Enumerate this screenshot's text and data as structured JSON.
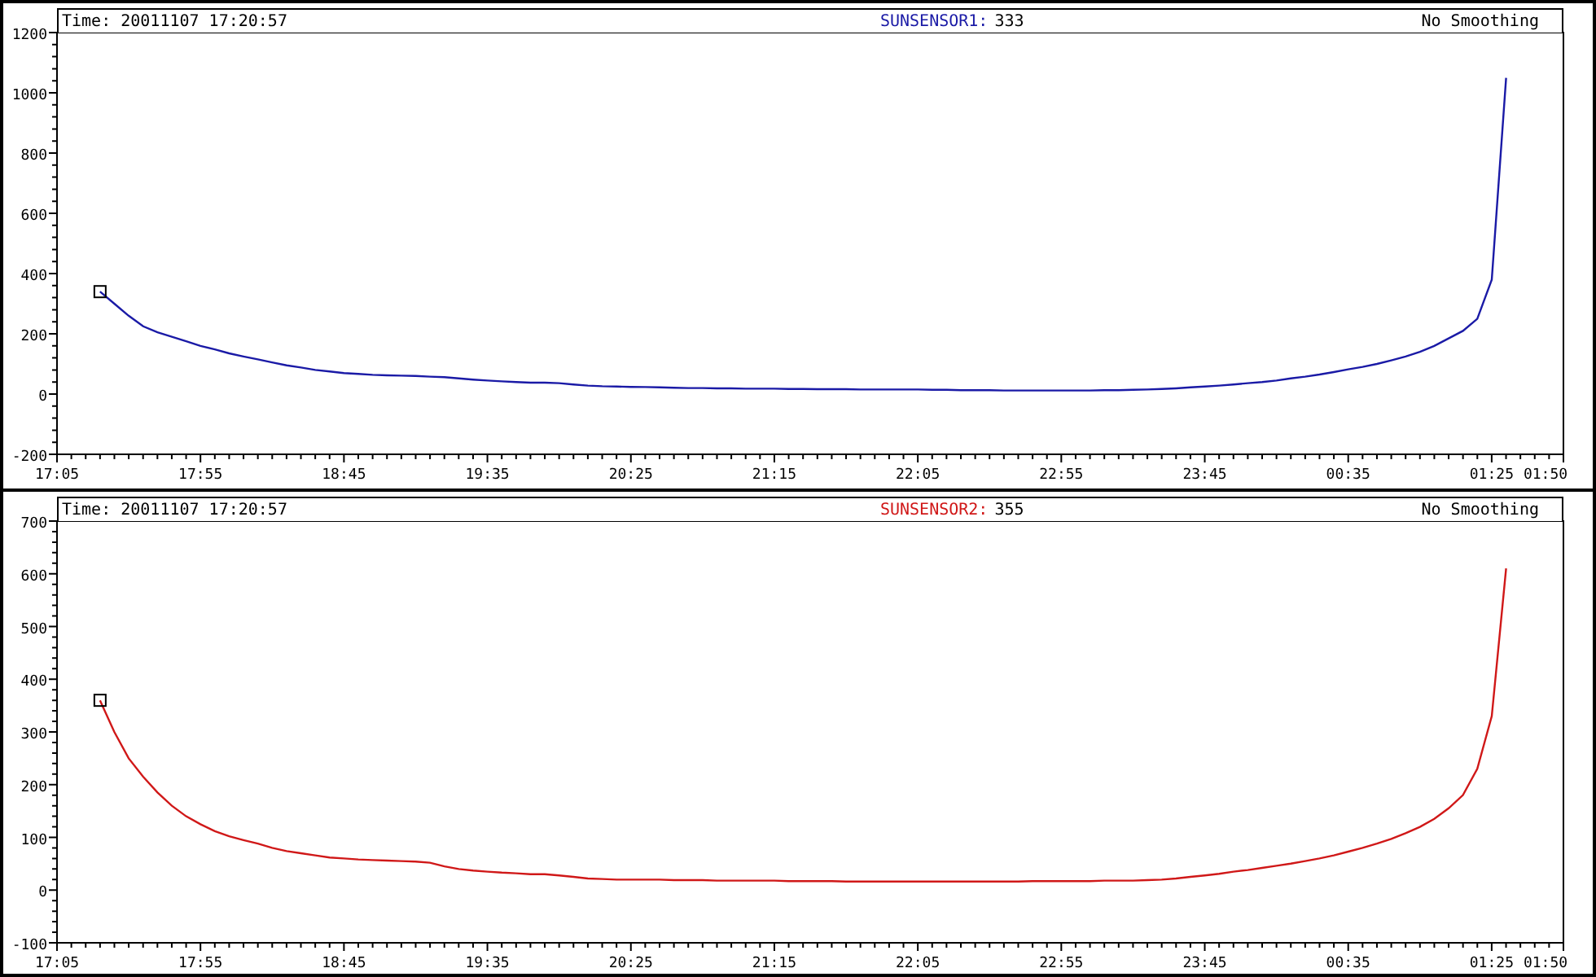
{
  "panels": [
    {
      "header": {
        "time": "Time: 20011107 17:20:57",
        "sensor": "SUNSENSOR1:",
        "reading": "333",
        "smoothing": "No Smoothing"
      },
      "chart_data": {
        "type": "line",
        "categories": [
          "17:05",
          null,
          null,
          null,
          null,
          null,
          null,
          null,
          null,
          null,
          "17:55",
          null,
          null,
          null,
          null,
          null,
          null,
          null,
          null,
          null,
          "18:45",
          null,
          null,
          null,
          null,
          null,
          null,
          null,
          null,
          null,
          "19:35",
          null,
          null,
          null,
          null,
          null,
          null,
          null,
          null,
          null,
          "20:25",
          null,
          null,
          null,
          null,
          null,
          null,
          null,
          null,
          null,
          "21:15",
          null,
          null,
          null,
          null,
          null,
          null,
          null,
          null,
          null,
          "22:05",
          null,
          null,
          null,
          null,
          null,
          null,
          null,
          null,
          null,
          "22:55",
          null,
          null,
          null,
          null,
          null,
          null,
          null,
          null,
          null,
          "23:45",
          null,
          null,
          null,
          null,
          null,
          null,
          null,
          null,
          null,
          "00:35",
          null,
          null,
          null,
          null,
          null,
          null,
          null,
          null,
          null,
          "01:25",
          null,
          null,
          null,
          null,
          "01:50"
        ],
        "series": [
          {
            "color": "#1a1aa6",
            "values": [
              null,
              null,
              null,
              340,
              300,
              260,
              225,
              205,
              190,
              175,
              160,
              148,
              135,
              125,
              115,
              105,
              95,
              88,
              80,
              75,
              70,
              67,
              64,
              62,
              61,
              60,
              58,
              56,
              52,
              48,
              45,
              42,
              40,
              38,
              38,
              36,
              32,
              28,
              26,
              25,
              24,
              23,
              22,
              21,
              20,
              20,
              19,
              19,
              18,
              18,
              18,
              17,
              17,
              16,
              16,
              16,
              15,
              15,
              15,
              15,
              15,
              14,
              14,
              13,
              13,
              13,
              12,
              12,
              12,
              12,
              12,
              12,
              12,
              13,
              13,
              14,
              15,
              17,
              19,
              22,
              25,
              28,
              32,
              36,
              40,
              45,
              52,
              58,
              65,
              73,
              82,
              90,
              100,
              112,
              125,
              140,
              160,
              185,
              210,
              250,
              380,
              1050,
              null,
              null,
              null,
              null
            ]
          }
        ],
        "ylim": [
          -200,
          1200
        ],
        "yticks": [
          -200,
          0,
          200,
          400,
          600,
          800,
          1000,
          1200
        ]
      }
    },
    {
      "header": {
        "time": "Time: 20011107 17:20:57",
        "sensor": "SUNSENSOR2:",
        "reading": "355",
        "smoothing": "No Smoothing"
      },
      "chart_data": {
        "type": "line",
        "categories": [
          "17:05",
          null,
          null,
          null,
          null,
          null,
          null,
          null,
          null,
          null,
          "17:55",
          null,
          null,
          null,
          null,
          null,
          null,
          null,
          null,
          null,
          "18:45",
          null,
          null,
          null,
          null,
          null,
          null,
          null,
          null,
          null,
          "19:35",
          null,
          null,
          null,
          null,
          null,
          null,
          null,
          null,
          null,
          "20:25",
          null,
          null,
          null,
          null,
          null,
          null,
          null,
          null,
          null,
          "21:15",
          null,
          null,
          null,
          null,
          null,
          null,
          null,
          null,
          null,
          "22:05",
          null,
          null,
          null,
          null,
          null,
          null,
          null,
          null,
          null,
          "22:55",
          null,
          null,
          null,
          null,
          null,
          null,
          null,
          null,
          null,
          "23:45",
          null,
          null,
          null,
          null,
          null,
          null,
          null,
          null,
          null,
          "00:35",
          null,
          null,
          null,
          null,
          null,
          null,
          null,
          null,
          null,
          "01:25",
          null,
          null,
          null,
          null,
          "01:50"
        ],
        "series": [
          {
            "color": "#d01818",
            "values": [
              null,
              null,
              null,
              360,
              300,
              250,
              215,
              185,
              160,
              140,
              125,
              112,
              102,
              95,
              88,
              80,
              74,
              70,
              66,
              62,
              60,
              58,
              57,
              56,
              55,
              54,
              52,
              45,
              40,
              37,
              35,
              33,
              32,
              30,
              30,
              28,
              25,
              22,
              21,
              20,
              20,
              20,
              20,
              19,
              19,
              19,
              18,
              18,
              18,
              18,
              18,
              17,
              17,
              17,
              17,
              16,
              16,
              16,
              16,
              16,
              16,
              16,
              16,
              16,
              16,
              16,
              16,
              16,
              17,
              17,
              17,
              17,
              17,
              18,
              18,
              18,
              19,
              20,
              22,
              25,
              28,
              31,
              35,
              38,
              42,
              46,
              50,
              55,
              60,
              66,
              73,
              80,
              88,
              97,
              108,
              120,
              135,
              155,
              180,
              230,
              330,
              610,
              null,
              null,
              null,
              null
            ]
          }
        ],
        "ylim": [
          -100,
          700
        ],
        "yticks": [
          -100,
          0,
          100,
          200,
          300,
          400,
          500,
          600,
          700
        ]
      }
    }
  ]
}
